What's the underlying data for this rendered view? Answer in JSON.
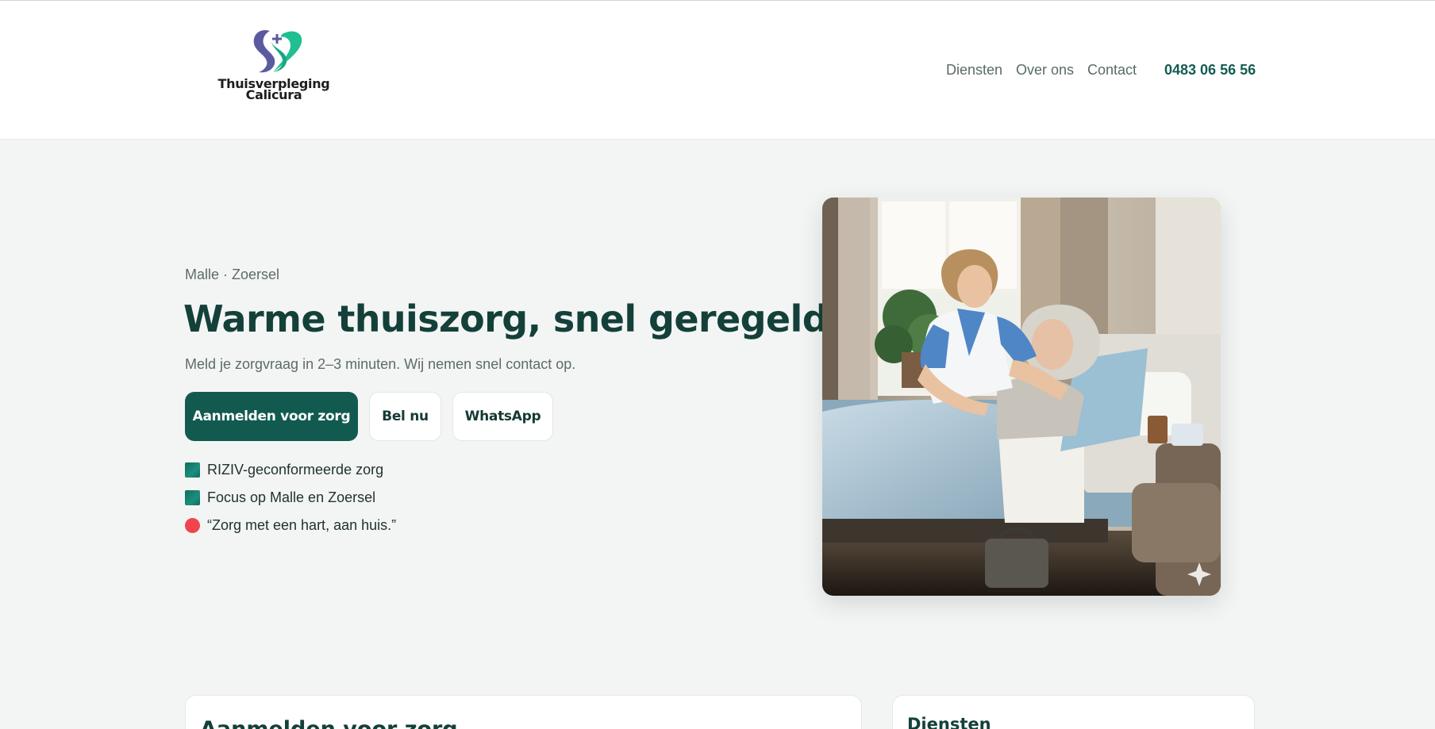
{
  "brand": {
    "name_line1": "Thuisverpleging",
    "name_line2": "Calicura",
    "logo_icon": "heart-cross-logo",
    "colors": {
      "primary": "#125a4f",
      "accent_purple": "#5b5aa0",
      "accent_green": "#1fbf8f",
      "alert": "#f0454d"
    }
  },
  "nav": {
    "items": [
      {
        "label": "Diensten"
      },
      {
        "label": "Over ons"
      },
      {
        "label": "Contact"
      }
    ],
    "phone": "0483 06 56 56"
  },
  "hero": {
    "eyebrow": "Malle · Zoersel",
    "title": "Warme thuiszorg, snel geregeld.",
    "lead": "Meld je zorgvraag in 2–3 minuten. Wij nemen snel contact op.",
    "buttons": {
      "primary": "Aanmelden voor zorg",
      "call": "Bel nu",
      "whatsapp": "WhatsApp"
    },
    "features": [
      {
        "text": "RIZIV-geconformeerde zorg",
        "marker": "square"
      },
      {
        "text": "Focus op Malle en Zoersel",
        "marker": "square"
      },
      {
        "text": "“Zorg met een hart, aan huis.”",
        "marker": "dot"
      }
    ],
    "image_icon": "sparkle-icon"
  },
  "sections": {
    "form_title": "Aanmelden voor zorg",
    "services_title": "Diensten"
  }
}
